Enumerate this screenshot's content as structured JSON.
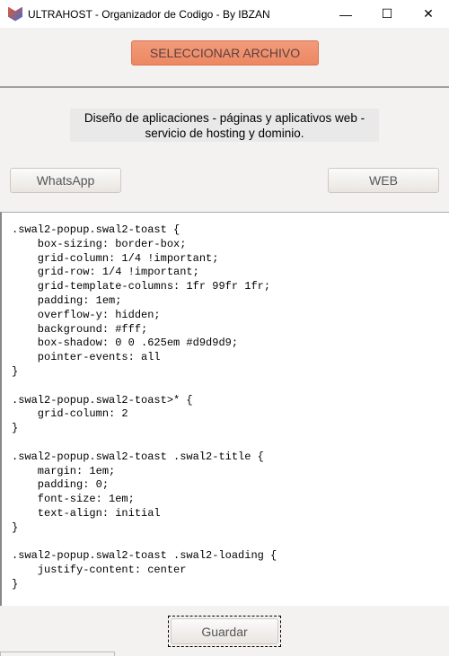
{
  "window": {
    "title": "ULTRAHOST - Organizador de Codigo - By IBZAN",
    "minimize": "—",
    "maximize": "☐",
    "close": "✕"
  },
  "select_button": "SELECCIONAR ARCHIVO",
  "description": "Diseño de aplicaciones - páginas y aplicativos web - servicio de hosting y dominio.",
  "whatsapp_button": "WhatsApp",
  "web_button": "WEB",
  "code": ".swal2-popup.swal2-toast {\n    box-sizing: border-box;\n    grid-column: 1/4 !important;\n    grid-row: 1/4 !important;\n    grid-template-columns: 1fr 99fr 1fr;\n    padding: 1em;\n    overflow-y: hidden;\n    background: #fff;\n    box-shadow: 0 0 .625em #d9d9d9;\n    pointer-events: all\n}\n\n.swal2-popup.swal2-toast>* {\n    grid-column: 2\n}\n\n.swal2-popup.swal2-toast .swal2-title {\n    margin: 1em;\n    padding: 0;\n    font-size: 1em;\n    text-align: initial\n}\n\n.swal2-popup.swal2-toast .swal2-loading {\n    justify-content: center\n}",
  "save_button": "Guardar"
}
